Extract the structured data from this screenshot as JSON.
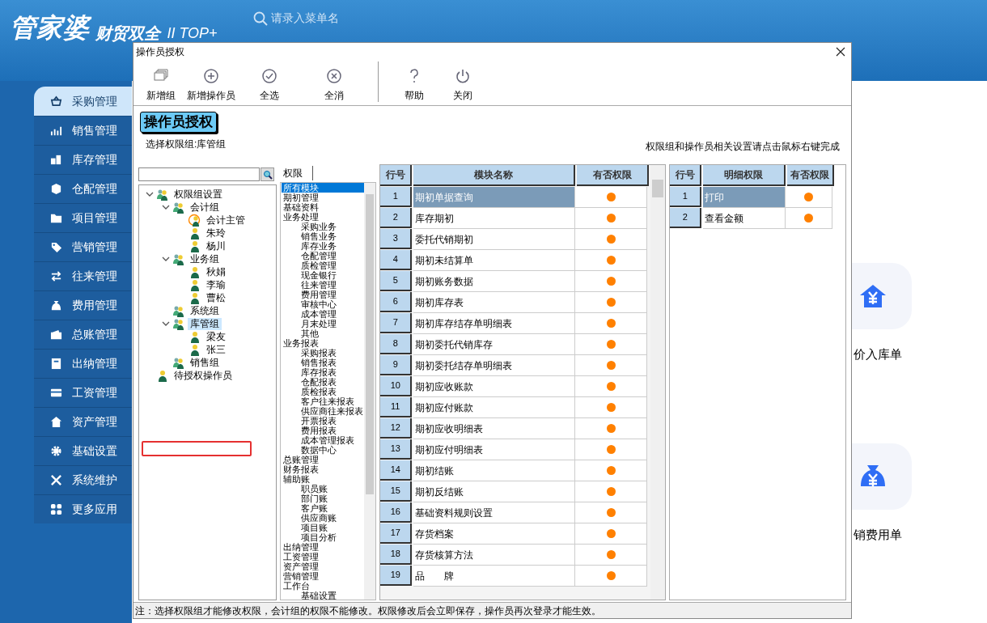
{
  "header": {
    "logo": "管家婆",
    "subtitle": "财贸双全",
    "edition": "II TOP+",
    "search": {
      "placeholder": "请录入菜单名"
    }
  },
  "sidebar": {
    "items": [
      {
        "label": "采购管理",
        "selected": true
      },
      {
        "label": "销售管理",
        "selected": false
      },
      {
        "label": "库存管理",
        "selected": false
      },
      {
        "label": "仓配管理",
        "selected": false
      },
      {
        "label": "项目管理",
        "selected": false
      },
      {
        "label": "营销管理",
        "selected": false
      },
      {
        "label": "往来管理",
        "selected": false
      },
      {
        "label": "费用管理",
        "selected": false
      },
      {
        "label": "总账管理",
        "selected": false
      },
      {
        "label": "出纳管理",
        "selected": false
      },
      {
        "label": "工资管理",
        "selected": false
      },
      {
        "label": "资产管理",
        "selected": false
      },
      {
        "label": "基础设置",
        "selected": false
      },
      {
        "label": "系统维护",
        "selected": false
      },
      {
        "label": "更多应用",
        "selected": false
      }
    ]
  },
  "shortcuts": [
    {
      "label": "价入库单"
    },
    {
      "label": "销费用单"
    }
  ],
  "dialog": {
    "title": "操作员授权",
    "toolbar": [
      {
        "label": "新增组"
      },
      {
        "label": "新增操作员"
      },
      {
        "label": "全选"
      },
      {
        "label": "全消"
      },
      {
        "label": "帮助"
      },
      {
        "label": "关闭"
      }
    ],
    "heading": "操作员授权",
    "group_label": "选择权限组:库管组",
    "hint": "权限组和操作员相关设置请点击鼠标右键完成",
    "tree": [
      {
        "label": "权限组设置",
        "kind": "group",
        "expanded": true,
        "selected": false,
        "children": [
          {
            "label": "会计组",
            "kind": "group",
            "expanded": true,
            "selected": false,
            "children": [
              {
                "label": "会计主管",
                "kind": "admin",
                "selected": false
              },
              {
                "label": "朱玲",
                "kind": "user",
                "selected": false
              },
              {
                "label": "杨川",
                "kind": "user",
                "selected": false
              }
            ]
          },
          {
            "label": "业务组",
            "kind": "group",
            "expanded": true,
            "selected": false,
            "children": [
              {
                "label": "秋娟",
                "kind": "user",
                "selected": false
              },
              {
                "label": "李瑜",
                "kind": "user",
                "selected": false
              },
              {
                "label": "曹松",
                "kind": "user",
                "selected": false
              }
            ]
          },
          {
            "label": "系统组",
            "kind": "group",
            "selected": false
          },
          {
            "label": "库管组",
            "kind": "group",
            "expanded": true,
            "selected": true,
            "highlighted": true,
            "children": [
              {
                "label": "梁友",
                "kind": "user",
                "selected": false
              },
              {
                "label": "张三",
                "kind": "user",
                "selected": false
              }
            ]
          },
          {
            "label": "销售组",
            "kind": "group",
            "selected": false
          }
        ]
      },
      {
        "label": "待授权操作员",
        "kind": "user",
        "selected": false
      }
    ],
    "tab": "权限",
    "modules": [
      {
        "label": "所有模块",
        "selected": true
      },
      {
        "label": "期初管理",
        "selected": false
      },
      {
        "label": "基础资料",
        "selected": false
      },
      {
        "label": "业务处理",
        "selected": false,
        "children": [
          {
            "label": "采购业务",
            "selected": false
          },
          {
            "label": "销售业务",
            "selected": false
          },
          {
            "label": "库存业务",
            "selected": false
          },
          {
            "label": "仓配管理",
            "selected": false
          },
          {
            "label": "质检管理",
            "selected": false
          },
          {
            "label": "现金银行",
            "selected": false
          },
          {
            "label": "往来管理",
            "selected": false
          },
          {
            "label": "费用管理",
            "selected": false
          },
          {
            "label": "审核中心",
            "selected": false
          },
          {
            "label": "成本管理",
            "selected": false
          },
          {
            "label": "月末处理",
            "selected": false
          },
          {
            "label": "其他",
            "selected": false
          }
        ]
      },
      {
        "label": "业务报表",
        "selected": false,
        "children": [
          {
            "label": "采购报表",
            "selected": false
          },
          {
            "label": "销售报表",
            "selected": false
          },
          {
            "label": "库存报表",
            "selected": false
          },
          {
            "label": "仓配报表",
            "selected": false
          },
          {
            "label": "质检报表",
            "selected": false
          },
          {
            "label": "客户往来报表",
            "selected": false
          },
          {
            "label": "供应商往来报表",
            "selected": false
          },
          {
            "label": "开票报表",
            "selected": false
          },
          {
            "label": "费用报表",
            "selected": false
          },
          {
            "label": "成本管理报表",
            "selected": false
          },
          {
            "label": "数据中心",
            "selected": false
          }
        ]
      },
      {
        "label": "总账管理",
        "selected": false
      },
      {
        "label": "财务报表",
        "selected": false
      },
      {
        "label": "辅助账",
        "selected": false,
        "children": [
          {
            "label": "职员账",
            "selected": false
          },
          {
            "label": "部门账",
            "selected": false
          },
          {
            "label": "客户账",
            "selected": false
          },
          {
            "label": "供应商账",
            "selected": false
          },
          {
            "label": "项目账",
            "selected": false
          },
          {
            "label": "项目分析",
            "selected": false
          }
        ]
      },
      {
        "label": "出纳管理",
        "selected": false
      },
      {
        "label": "工资管理",
        "selected": false
      },
      {
        "label": "资产管理",
        "selected": false
      },
      {
        "label": "营销管理",
        "selected": false
      },
      {
        "label": "工作台",
        "selected": false,
        "children": [
          {
            "label": "基础设置",
            "selected": false
          }
        ]
      }
    ],
    "module_table": {
      "columns": [
        "行号",
        "模块名称",
        "有否权限"
      ],
      "rows": [
        {
          "no": "1",
          "name": "期初单据查询",
          "granted": true,
          "selected": true
        },
        {
          "no": "2",
          "name": "库存期初",
          "granted": true,
          "selected": false
        },
        {
          "no": "3",
          "name": "委托代销期初",
          "granted": true,
          "selected": false
        },
        {
          "no": "4",
          "name": "期初未结算单",
          "granted": true,
          "selected": false
        },
        {
          "no": "5",
          "name": "期初账务数据",
          "granted": true,
          "selected": false
        },
        {
          "no": "6",
          "name": "期初库存表",
          "granted": true,
          "selected": false
        },
        {
          "no": "7",
          "name": "期初库存结存单明细表",
          "granted": true,
          "selected": false
        },
        {
          "no": "8",
          "name": "期初委托代销库存",
          "granted": true,
          "selected": false
        },
        {
          "no": "9",
          "name": "期初委托结存单明细表",
          "granted": true,
          "selected": false
        },
        {
          "no": "10",
          "name": "期初应收账款",
          "granted": true,
          "selected": false
        },
        {
          "no": "11",
          "name": "期初应付账款",
          "granted": true,
          "selected": false
        },
        {
          "no": "12",
          "name": "期初应收明细表",
          "granted": true,
          "selected": false
        },
        {
          "no": "13",
          "name": "期初应付明细表",
          "granted": true,
          "selected": false
        },
        {
          "no": "14",
          "name": "期初结账",
          "granted": true,
          "selected": false
        },
        {
          "no": "15",
          "name": "期初反结账",
          "granted": true,
          "selected": false
        },
        {
          "no": "16",
          "name": "基础资料规则设置",
          "granted": true,
          "selected": false
        },
        {
          "no": "17",
          "name": "存货档案",
          "granted": true,
          "selected": false
        },
        {
          "no": "18",
          "name": "存货核算方法",
          "granted": true,
          "selected": false
        },
        {
          "no": "19",
          "name": "品　　牌",
          "granted": true,
          "selected": false
        }
      ]
    },
    "detail_table": {
      "columns": [
        "行号",
        "明细权限",
        "有否权限"
      ],
      "rows": [
        {
          "no": "1",
          "name": "打印",
          "granted": true,
          "selected": true
        },
        {
          "no": "2",
          "name": "查看金额",
          "granted": true,
          "selected": false
        }
      ]
    },
    "status_bar": "注：选择权限组才能修改权限，会计组的权限不能修改。权限修改后会立即保存，操作员再次登录才能生效。"
  }
}
